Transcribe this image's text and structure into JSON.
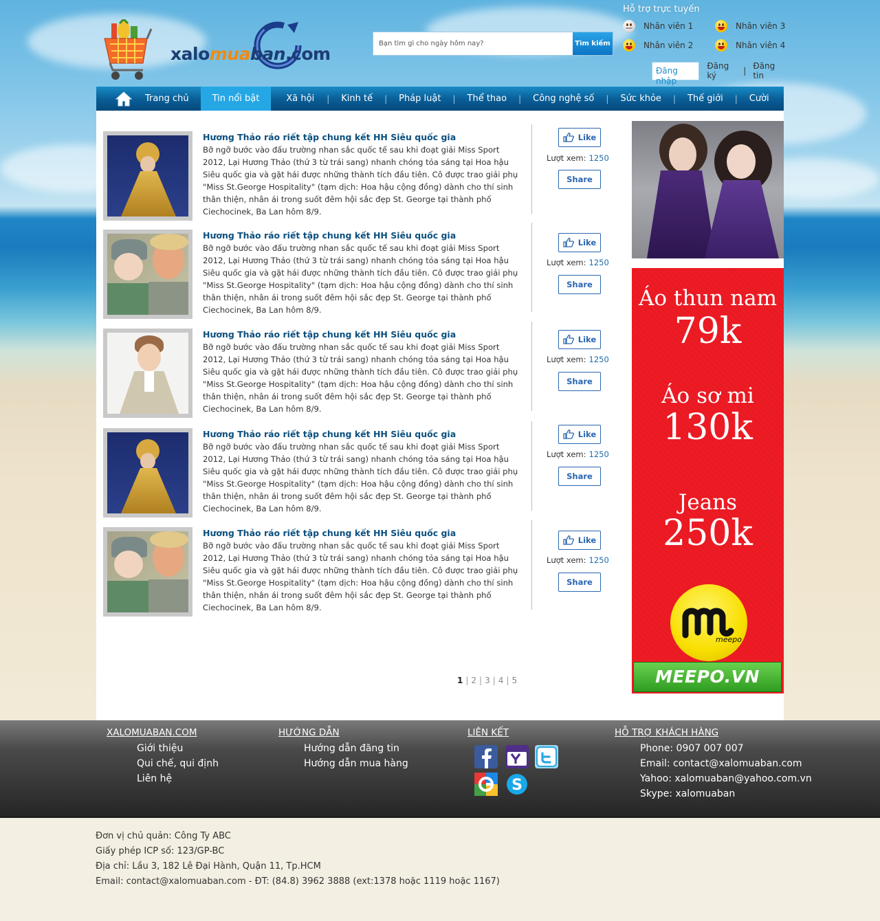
{
  "header": {
    "logo_prefix": "xalo",
    "logo_middle": "mua",
    "logo_brand": "ban",
    "logo_suffix": ".com",
    "search_placeholder": "Bạn tìm gì cho ngày hôm nay?",
    "search_button": "Tìm kiếm",
    "support_title": "Hỗ trợ trực tuyến",
    "staff": [
      "Nhân viên 1",
      "Nhân viên 2",
      "Nhân viên 3",
      "Nhân viên 4"
    ],
    "login": "Đăng nhập",
    "register": "Đăng ký",
    "separator": "|",
    "post": "Đăng tin"
  },
  "nav": {
    "items": [
      "Trang chủ",
      "Tin nổi bật",
      "Xã hội",
      "Kinh tế",
      "Pháp luật",
      "Thể thao",
      "Công nghệ số",
      "Sức khỏe",
      "Thế giới",
      "Cười"
    ],
    "active_index": 1,
    "divider": "|"
  },
  "articles": [
    {
      "title": "Hương Thảo ráo riết tập chung kết HH Siêu quốc gia",
      "desc": "Bỡ ngỡ bước vào đấu trường nhan sắc quốc tế sau khi đoạt giải Miss Sport 2012, Lại Hương Thảo (thứ 3 từ trái sang) nhanh chóng tỏa sáng tại Hoa hậu Siêu quốc gia và gặt hái được những thành tích đầu tiên. Cô được trao giải phụ \"Miss St.George Hospitality\" (tạm dịch: Hoa hậu cộng đồng) dành cho thí sinh thân thiện, nhân ái trong suốt đêm hội sắc đẹp St. George tại thành phố Ciechocinek, Ba Lan hôm 8/9.",
      "like": "Like",
      "views_label": "Lượt xem:",
      "views": "1250",
      "share": "Share",
      "image": "ao-dai-photo"
    },
    {
      "title": "Hương Thảo ráo riết tập chung kết HH Siêu quốc gia",
      "desc": "Bỡ ngỡ bước vào đấu trường nhan sắc quốc tế sau khi đoạt giải Miss Sport 2012, Lại Hương Thảo (thứ 3 từ trái sang) nhanh chóng tỏa sáng tại Hoa hậu Siêu quốc gia và gặt hái được những thành tích đầu tiên. Cô được trao giải phụ \"Miss St.George Hospitality\" (tạm dịch: Hoa hậu cộng đồng) dành cho thí sinh thân thiện, nhân ái trong suốt đêm hội sắc đẹp St. George tại thành phố Ciechocinek, Ba Lan hôm 8/9.",
      "like": "Like",
      "views_label": "Lượt xem:",
      "views": "1250",
      "share": "Share",
      "image": "father-child-photo"
    },
    {
      "title": "Hương Thảo ráo riết tập chung kết HH Siêu quốc gia",
      "desc": "Bỡ ngỡ bước vào đấu trường nhan sắc quốc tế sau khi đoạt giải Miss Sport 2012, Lại Hương Thảo (thứ 3 từ trái sang) nhanh chóng tỏa sáng tại Hoa hậu Siêu quốc gia và gặt hái được những thành tích đầu tiên. Cô được trao giải phụ \"Miss St.George Hospitality\" (tạm dịch: Hoa hậu cộng đồng) dành cho thí sinh thân thiện, nhân ái trong suốt đêm hội sắc đẹp St. George tại thành phố Ciechocinek, Ba Lan hôm 8/9.",
      "like": "Like",
      "views_label": "Lượt xem:",
      "views": "1250",
      "share": "Share",
      "image": "man-suit-photo"
    },
    {
      "title": "Hương Thảo ráo riết tập chung kết HH Siêu quốc gia",
      "desc": "Bỡ ngỡ bước vào đấu trường nhan sắc quốc tế sau khi đoạt giải Miss Sport 2012, Lại Hương Thảo (thứ 3 từ trái sang) nhanh chóng tỏa sáng tại Hoa hậu Siêu quốc gia và gặt hái được những thành tích đầu tiên. Cô được trao giải phụ \"Miss St.George Hospitality\" (tạm dịch: Hoa hậu cộng đồng) dành cho thí sinh thân thiện, nhân ái trong suốt đêm hội sắc đẹp St. George tại thành phố Ciechocinek, Ba Lan hôm 8/9.",
      "like": "Like",
      "views_label": "Lượt xem:",
      "views": "1250",
      "share": "Share",
      "image": "ao-dai-photo"
    },
    {
      "title": "Hương Thảo ráo riết tập chung kết HH Siêu quốc gia",
      "desc": "Bỡ ngỡ bước vào đấu trường nhan sắc quốc tế sau khi đoạt giải Miss Sport 2012, Lại Hương Thảo (thứ 3 từ trái sang) nhanh chóng tỏa sáng tại Hoa hậu Siêu quốc gia và gặt hái được những thành tích đầu tiên. Cô được trao giải phụ \"Miss St.George Hospitality\" (tạm dịch: Hoa hậu cộng đồng) dành cho thí sinh thân thiện, nhân ái trong suốt đêm hội sắc đẹp St. George tại thành phố Ciechocinek, Ba Lan hôm 8/9.",
      "like": "Like",
      "views_label": "Lượt xem:",
      "views": "1250",
      "share": "Share",
      "image": "father-child-photo"
    }
  ],
  "pagination": {
    "pages": [
      "1",
      "2",
      "3",
      "4",
      "5"
    ],
    "current": "1",
    "separator": "|"
  },
  "ads": {
    "ad2_lines": [
      "Áo thun nam",
      "79k",
      "Áo sơ mi",
      "130k",
      "Jeans",
      "250k"
    ],
    "meepo_logo_text": "meepo",
    "meepo_banner": "MEEPO.VN"
  },
  "footer": {
    "col1": {
      "heading": "XALOMUABAN.COM",
      "links": [
        "Giới thiệu",
        "Qui chế, qui định",
        "Liên hệ"
      ]
    },
    "col2": {
      "heading": "HƯỚNG DẪN",
      "links": [
        "Hướng dẫn đăng tin",
        "Hướng dẫn mua hàng"
      ]
    },
    "col3": {
      "heading": "LIÊN KẾT",
      "icons": [
        "facebook-icon",
        "yahoo-icon",
        "twitter-icon",
        "google-icon",
        "skype-icon"
      ]
    },
    "col4": {
      "heading": "HỖ TRỢ KHÁCH HÀNG",
      "lines": [
        "Phone: 0907 007 007",
        "Email: contact@xalomuaban.com",
        "Yahoo: xalomuaban@yahoo.com.vn",
        "Skype: xalomuaban"
      ]
    }
  },
  "company": [
    "Đơn vị chủ quản: Công Ty ABC",
    "Giấy phép ICP số: 123/GP-BC",
    "Địa chỉ: Lầu 3, 182 Lê Đại Hành, Quận 11, Tp.HCM",
    "Email: contact@xalomuaban.com - ĐT: (84.8) 3962 3888 (ext:1378 hoặc 1119 hoặc 1167)"
  ],
  "colors": {
    "nav_active": "#25a7e5",
    "title": "#0b4f7d",
    "views_count": "#1c6eb0",
    "ad_red": "#ee1b24",
    "meepo_green": "#3aa82a"
  }
}
